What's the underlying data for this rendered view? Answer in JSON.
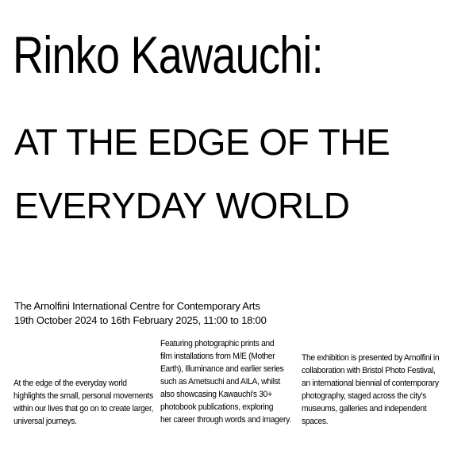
{
  "title": {
    "line1": "Rinko Kawauchi:",
    "line2": "AT THE EDGE OF THE",
    "line3": "EVERYDAY WORLD"
  },
  "venue": "The Arnolfini International Centre for Contemporary Arts",
  "dates": "19th October 2024 to 16th February 2025, 11:00 to 18:00",
  "columns": {
    "col1": [
      "At the edge of the everyday world",
      "highlights the small, personal movements",
      "within our lives that go on to create larger,",
      "universal journeys."
    ],
    "col2": [
      "Featuring photographic prints and",
      "film installations from M/E (Mother",
      "Earth), Illuminance and earlier series",
      "such as Ametsuchi and AILA, whilst",
      "also showcasing Kawauchi's 30+",
      "photobook publications, exploring",
      "her career through words and imagery."
    ],
    "col3": [
      "The exhibition is presented by Arnolfini in",
      "collaboration with Bristol Photo Festival,",
      "an international biennial of contemporary",
      "photography, staged across the city's",
      "museums, galleries and independent",
      "spaces."
    ]
  }
}
